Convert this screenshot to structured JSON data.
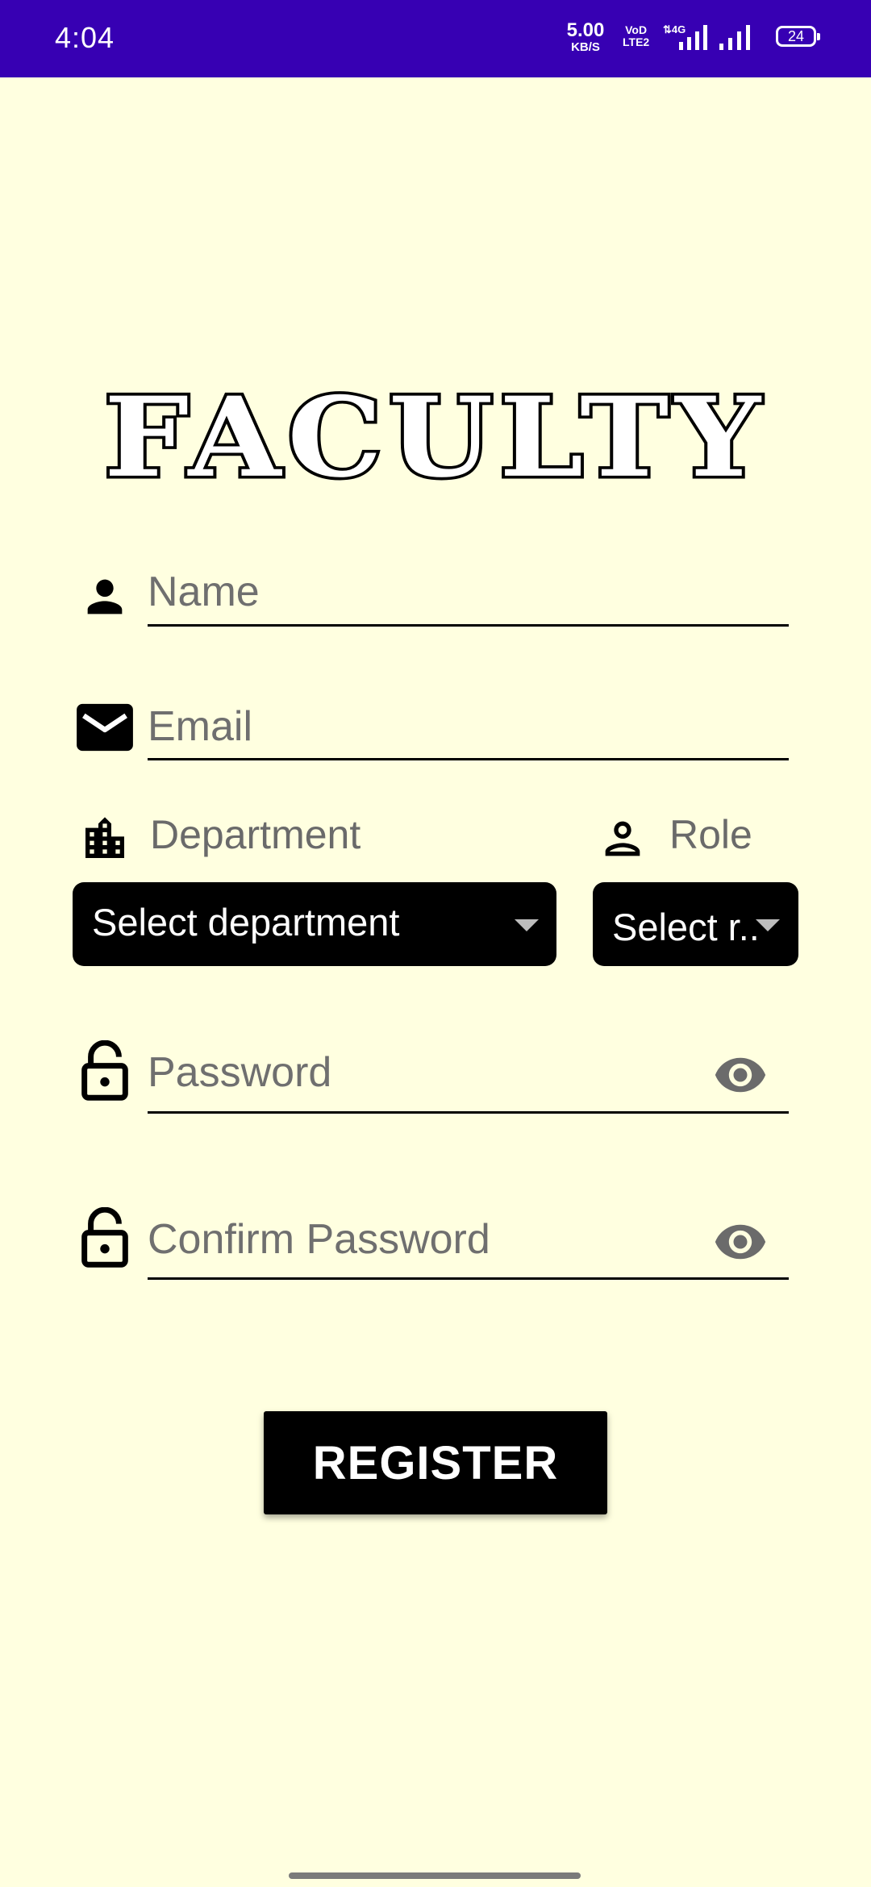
{
  "status_bar": {
    "time": "4:04",
    "net_speed_value": "5.00",
    "net_speed_unit": "KB/S",
    "volte_line1": "VoD",
    "volte_line2": "LTE2",
    "battery_level": "24",
    "icons": [
      "data-arrows-4g-icon",
      "signal-icon",
      "signal-icon",
      "battery-icon"
    ],
    "background": "#3700b3"
  },
  "header": {
    "title": "FACULTY"
  },
  "form": {
    "name": {
      "placeholder": "Name",
      "icon": "person-icon"
    },
    "email": {
      "placeholder": "Email",
      "icon": "mail-icon"
    },
    "department": {
      "label": "Department",
      "icon": "building-icon",
      "selected": "Select department"
    },
    "role": {
      "label": "Role",
      "icon": "person-outline-icon",
      "selected": "Select r.."
    },
    "password": {
      "placeholder": "Password",
      "icon": "lock-open-icon",
      "toggle_icon": "eye-icon"
    },
    "confirm_password": {
      "placeholder": "Confirm Password",
      "icon": "lock-open-icon",
      "toggle_icon": "eye-icon"
    },
    "register_label": "REGISTER"
  },
  "colors": {
    "background": "#ffffe0",
    "accent": "#3700b3",
    "button": "#000000",
    "hint_text": "#6f6f6f"
  }
}
